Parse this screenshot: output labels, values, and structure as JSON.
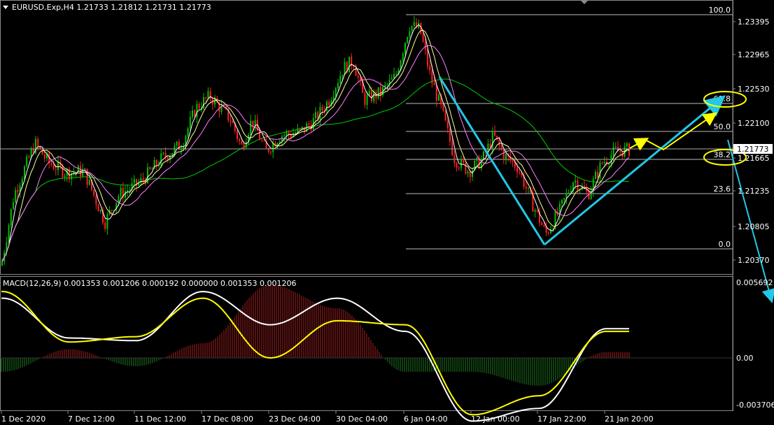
{
  "header": {
    "symbol_line": "EURUSD.Exp,H4  1.21733 1.21812 1.21731 1.21773"
  },
  "macd_header": {
    "label": "MACD(12,26,9) 0.001353 0.001206 0.000192 0.000000 0.001353 0.001206"
  },
  "price_axis": {
    "ticks": [
      "1.23395",
      "1.22965",
      "1.22530",
      "1.22100",
      "1.21665",
      "1.21235",
      "1.20805",
      "1.20370"
    ],
    "current_price": "1.21773"
  },
  "macd_axis": {
    "ticks": [
      "0.005692",
      "0.00",
      "-0.003706"
    ]
  },
  "time_axis": {
    "ticks": [
      "1 Dec 2020",
      "7 Dec 12:00",
      "11 Dec 12:00",
      "17 Dec 08:00",
      "23 Dec 04:00",
      "30 Dec 04:00",
      "6 Jan 04:00",
      "12 Jan 00:00",
      "17 Jan 22:00",
      "21 Jan 20:00"
    ]
  },
  "fibonacci": {
    "levels": [
      "100.0",
      "61.8",
      "50.0",
      "38.2",
      "23.6",
      "0.0"
    ],
    "high": 1.2349,
    "low": 1.2059
  },
  "colors": {
    "background": "#000000",
    "bull_candle": "#00c000",
    "bear_candle": "#ff2020",
    "ma_fast": "#ffffff",
    "ma_mid": "#ffff99",
    "ma_pink": "#ff80ff",
    "ma_slow": "#00cc00",
    "trend_arrow": "#22c8e6",
    "projection_arrow": "#ffff00",
    "macd_line": "#ffffff",
    "signal_line": "#ffff00",
    "hist_pos": "#aa2222",
    "hist_neg": "#1f7a1f"
  },
  "chart_data": [
    {
      "type": "candlestick",
      "title": "EURUSD.Exp,H4",
      "ylim": [
        1.2025,
        1.2355
      ],
      "last": {
        "open": 1.21733,
        "high": 1.21812,
        "low": 1.21731,
        "close": 1.21773
      },
      "close_path": {
        "x": [
          "1 Dec 2020",
          "7 Dec 12:00",
          "11 Dec 12:00",
          "17 Dec 08:00",
          "23 Dec 04:00",
          "30 Dec 04:00",
          "6 Jan 04:00",
          "12 Jan 00:00",
          "17 Jan 22:00",
          "21 Jan 20:00"
        ],
        "y": [
          1.203,
          1.2145,
          1.2125,
          1.2245,
          1.219,
          1.227,
          1.233,
          1.215,
          1.2075,
          1.2177
        ]
      }
    },
    {
      "type": "line",
      "title": "MACD(12,26,9)",
      "ylim": [
        -0.003706,
        0.005692
      ],
      "series": [
        {
          "name": "MACD",
          "values": [
            0.0045,
            0.0015,
            0.0013,
            0.005,
            0.0025,
            0.0045,
            0.002,
            -0.005,
            -0.004,
            0.0022
          ]
        },
        {
          "name": "Signal",
          "values": [
            0.005,
            0.0012,
            0.0016,
            0.0045,
            0.0,
            0.0028,
            0.0025,
            -0.0045,
            -0.003,
            0.002
          ]
        }
      ],
      "histogram_end": 0.000192
    }
  ]
}
